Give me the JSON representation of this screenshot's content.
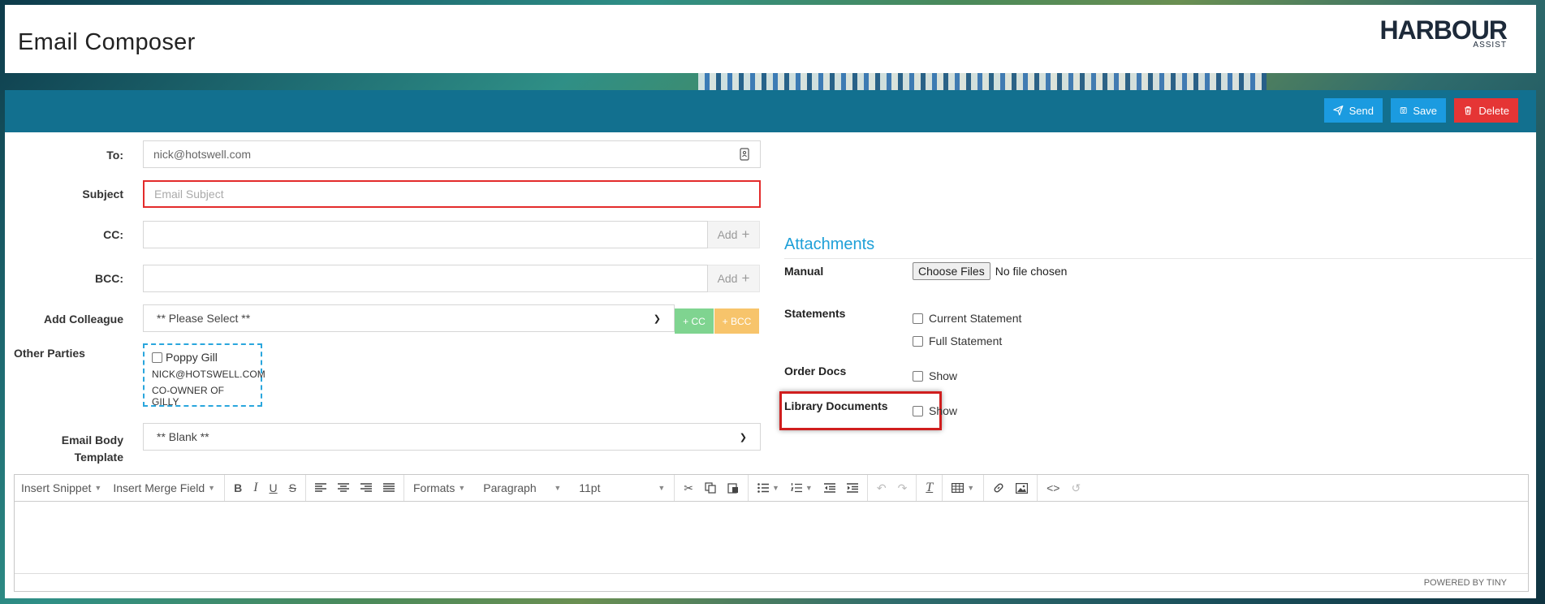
{
  "header": {
    "title": "Email Composer",
    "logo_main": "HARBOUR",
    "logo_sub": "ASSIST"
  },
  "toolbar": {
    "send_label": "Send",
    "save_label": "Save",
    "delete_label": "Delete"
  },
  "form": {
    "to_label": "To:",
    "to_value": "nick@hotswell.com",
    "subject_label": "Subject",
    "subject_placeholder": "Email Subject",
    "cc_label": "CC:",
    "bcc_label": "BCC:",
    "add_label": "Add",
    "colleague_label": "Add Colleague",
    "colleague_selected": "** Please Select **",
    "cc_btn": "+ CC",
    "bcc_btn": "+ BCC",
    "other_parties_label": "Other Parties",
    "party": {
      "name": "Poppy Gill",
      "email": "NICK@HOTSWELL.COM",
      "role": "CO-OWNER OF GILLY"
    },
    "template_label_1": "Email Body",
    "template_label_2": "Template",
    "template_selected": "** Blank **"
  },
  "attachments": {
    "title": "Attachments",
    "manual_label": "Manual",
    "choose_files": "Choose Files",
    "no_file": "No file chosen",
    "statements_label": "Statements",
    "current_statement": "Current Statement",
    "full_statement": "Full Statement",
    "order_docs_label": "Order Docs",
    "order_show": "Show",
    "library_label": "Library Documents",
    "library_show": "Show"
  },
  "editor": {
    "insert_snippet": "Insert Snippet",
    "insert_merge_field": "Insert Merge Field",
    "formats": "Formats",
    "paragraph": "Paragraph",
    "font_size": "11pt",
    "powered_by": "POWERED BY TINY"
  },
  "colors": {
    "toolbar": "#12708f",
    "send": "#1b9be0",
    "delete": "#e53535",
    "accent": "#1ea0d8",
    "highlight": "#d01e1e"
  }
}
